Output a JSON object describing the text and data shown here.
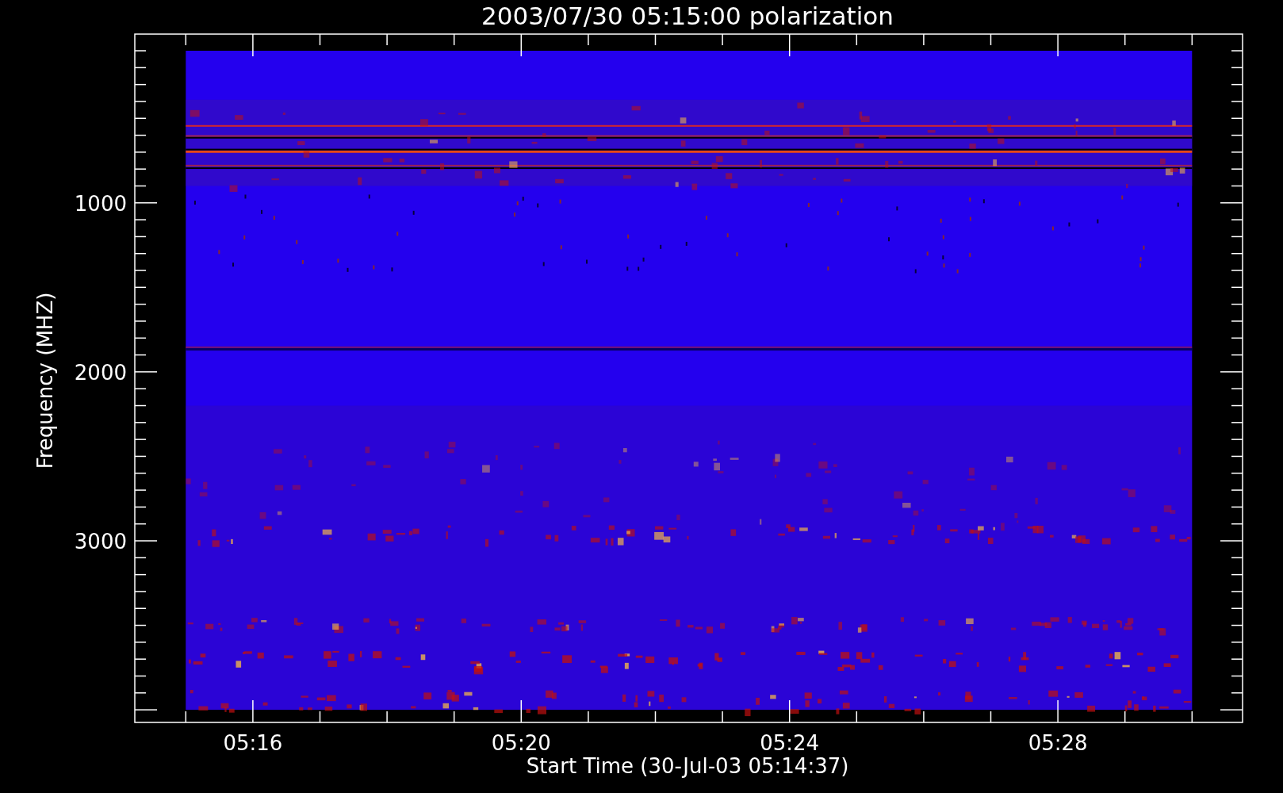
{
  "plot": {
    "title": "2003/07/30 05:15:00 polarization",
    "x_axis": {
      "label": "Start Time (30-Jul-03 05:14:37)",
      "tick_labels": [
        "05:16",
        "05:20",
        "05:24",
        "05:28"
      ]
    },
    "y_axis": {
      "label": "Frequency (MHZ)",
      "tick_labels": [
        "1000",
        "2000",
        "3000"
      ]
    }
  }
}
